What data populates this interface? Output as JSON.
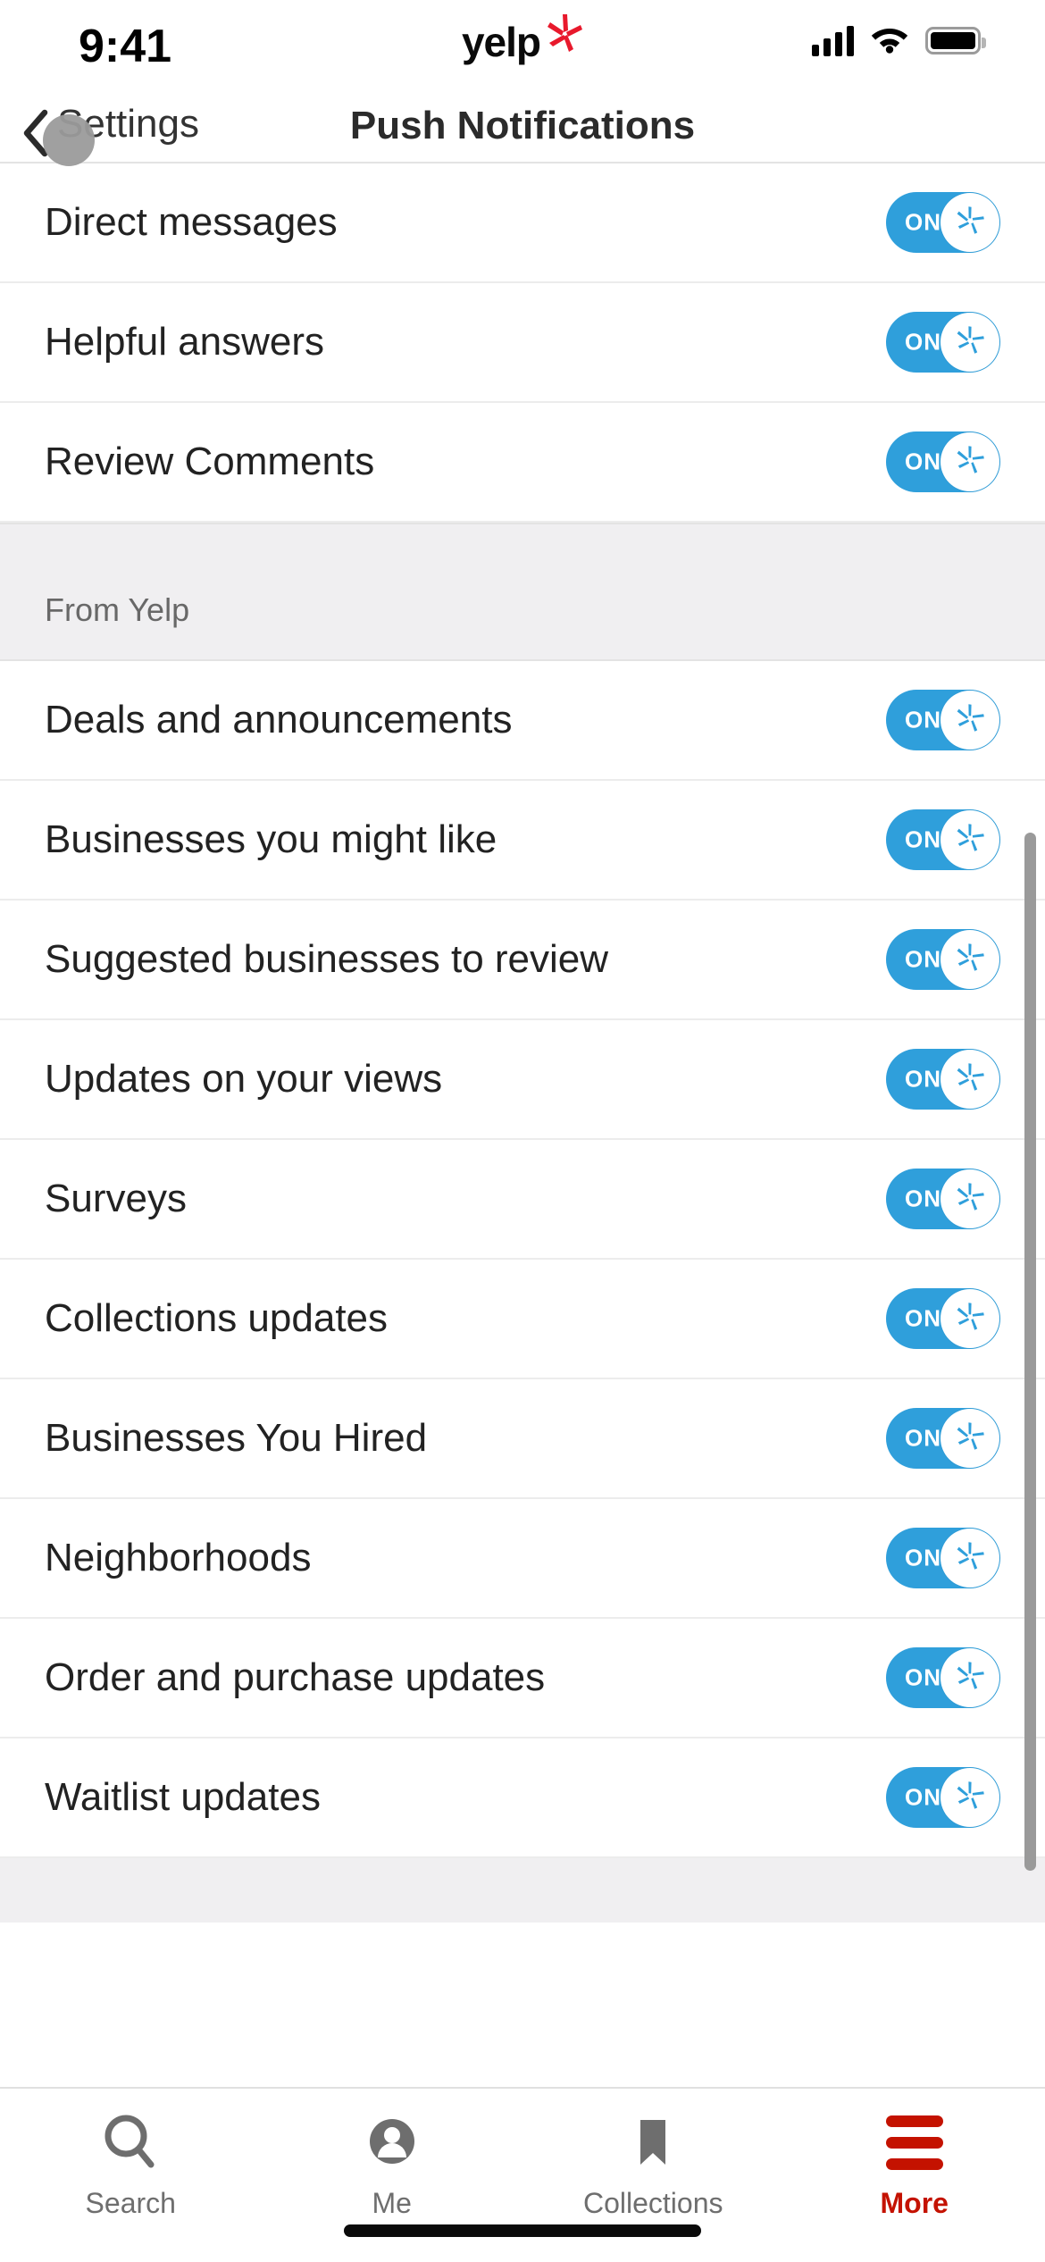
{
  "status_bar": {
    "time": "9:41",
    "brand_text": "yelp",
    "icons": [
      "cellular-signal-icon",
      "wifi-icon",
      "battery-icon"
    ]
  },
  "nav": {
    "back_label": "Settings",
    "back_icon": "chevron-left-icon",
    "title": "Push Notifications"
  },
  "toggle": {
    "on_label": "ON",
    "knob_icon": "yelp-burst-icon",
    "track_color": "#2f9fdb",
    "knob_color": "#ffffff"
  },
  "sections": [
    {
      "header": null,
      "rows": [
        {
          "label": "Direct messages",
          "state": "ON"
        },
        {
          "label": "Helpful answers",
          "state": "ON"
        },
        {
          "label": "Review Comments",
          "state": "ON"
        }
      ]
    },
    {
      "header": "From Yelp",
      "rows": [
        {
          "label": "Deals and announcements",
          "state": "ON"
        },
        {
          "label": "Businesses you might like",
          "state": "ON"
        },
        {
          "label": "Suggested businesses to review",
          "state": "ON"
        },
        {
          "label": "Updates on your views",
          "state": "ON"
        },
        {
          "label": "Surveys",
          "state": "ON"
        },
        {
          "label": "Collections updates",
          "state": "ON"
        },
        {
          "label": "Businesses You Hired",
          "state": "ON"
        },
        {
          "label": "Neighborhoods",
          "state": "ON"
        },
        {
          "label": "Order and purchase updates",
          "state": "ON"
        },
        {
          "label": "Waitlist updates",
          "state": "ON"
        }
      ]
    }
  ],
  "tabbar": {
    "items": [
      {
        "label": "Search",
        "icon": "search-icon",
        "active": false
      },
      {
        "label": "Me",
        "icon": "person-icon",
        "active": false
      },
      {
        "label": "Collections",
        "icon": "bookmark-icon",
        "active": false
      },
      {
        "label": "More",
        "icon": "hamburger-icon",
        "active": true
      }
    ],
    "active_color": "#c41200",
    "inactive_color": "#6e6e6e"
  }
}
